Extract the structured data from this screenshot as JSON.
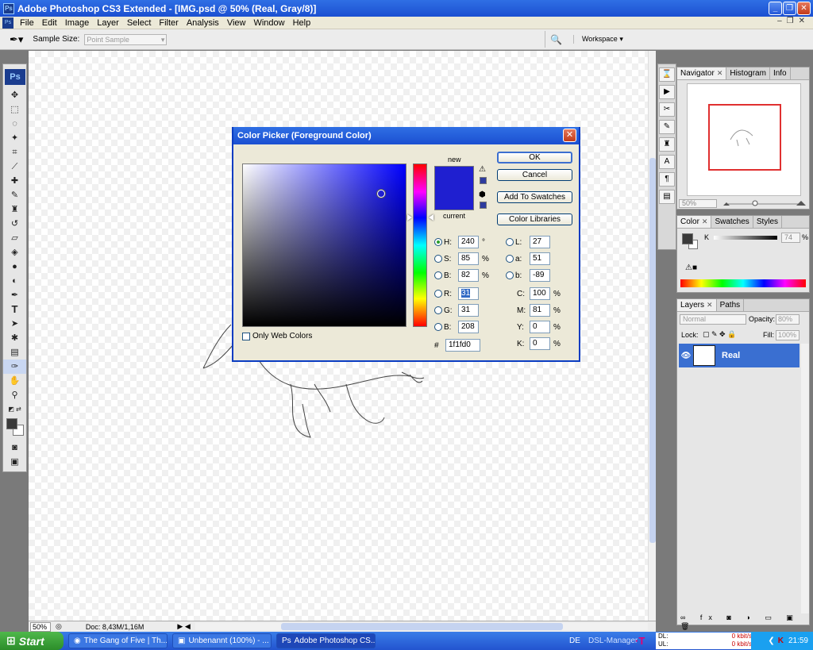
{
  "window": {
    "title": "Adobe Photoshop CS3 Extended - [IMG.psd @ 50% (Real, Gray/8)]",
    "app_icon": "Ps"
  },
  "menu": [
    "File",
    "Edit",
    "Image",
    "Layer",
    "Select",
    "Filter",
    "Analysis",
    "View",
    "Window",
    "Help"
  ],
  "options": {
    "sample_size_label": "Sample Size:",
    "sample_size_value": "Point Sample",
    "workspace_label": "Workspace"
  },
  "toolbox": {
    "logo": "Ps"
  },
  "status": {
    "zoom": "50%",
    "doc": "Doc: 8,43M/1,16M"
  },
  "navigator": {
    "tabs": [
      "Navigator",
      "Histogram",
      "Info"
    ],
    "zoom": "50%"
  },
  "color_panel": {
    "tabs": [
      "Color",
      "Swatches",
      "Styles"
    ],
    "channel": "K",
    "value": "74",
    "unit": "%"
  },
  "layers_panel": {
    "tabs": [
      "Layers",
      "Paths"
    ],
    "blend_mode": "Normal",
    "opacity_label": "Opacity:",
    "opacity": "80%",
    "lock_label": "Lock:",
    "fill_label": "Fill:",
    "fill": "100%",
    "layer_name": "Real"
  },
  "dialog": {
    "title": "Color Picker (Foreground Color)",
    "new_label": "new",
    "current_label": "current",
    "new_color": "#1f1fd0",
    "buttons": {
      "ok": "OK",
      "cancel": "Cancel",
      "add": "Add To Swatches",
      "libraries": "Color Libraries"
    },
    "only_web": "Only Web Colors",
    "hsb": [
      {
        "k": "H:",
        "v": "240",
        "u": "°"
      },
      {
        "k": "S:",
        "v": "85",
        "u": "%"
      },
      {
        "k": "B:",
        "v": "82",
        "u": "%"
      }
    ],
    "rgb": [
      {
        "k": "R:",
        "v": "31"
      },
      {
        "k": "G:",
        "v": "31"
      },
      {
        "k": "B:",
        "v": "208"
      }
    ],
    "lab": [
      {
        "k": "L:",
        "v": "27"
      },
      {
        "k": "a:",
        "v": "51"
      },
      {
        "k": "b:",
        "v": "-89"
      }
    ],
    "cmyk": [
      {
        "k": "C:",
        "v": "100",
        "u": "%"
      },
      {
        "k": "M:",
        "v": "81",
        "u": "%"
      },
      {
        "k": "Y:",
        "v": "0",
        "u": "%"
      },
      {
        "k": "K:",
        "v": "0",
        "u": "%"
      }
    ],
    "hex_label": "#",
    "hex": "1f1fd0"
  },
  "taskbar": {
    "start": "Start",
    "tasks": [
      "The Gang of Five | Th...",
      "Unbenannt (100%) - ...",
      "Adobe Photoshop CS..."
    ],
    "lang": "DE",
    "dsl": "DSL-Manager",
    "dl": "DL:",
    "ul": "UL:",
    "dl_rate": "0 kbit/s",
    "ul_rate": "0 kbit/s",
    "clock": "21:59"
  }
}
